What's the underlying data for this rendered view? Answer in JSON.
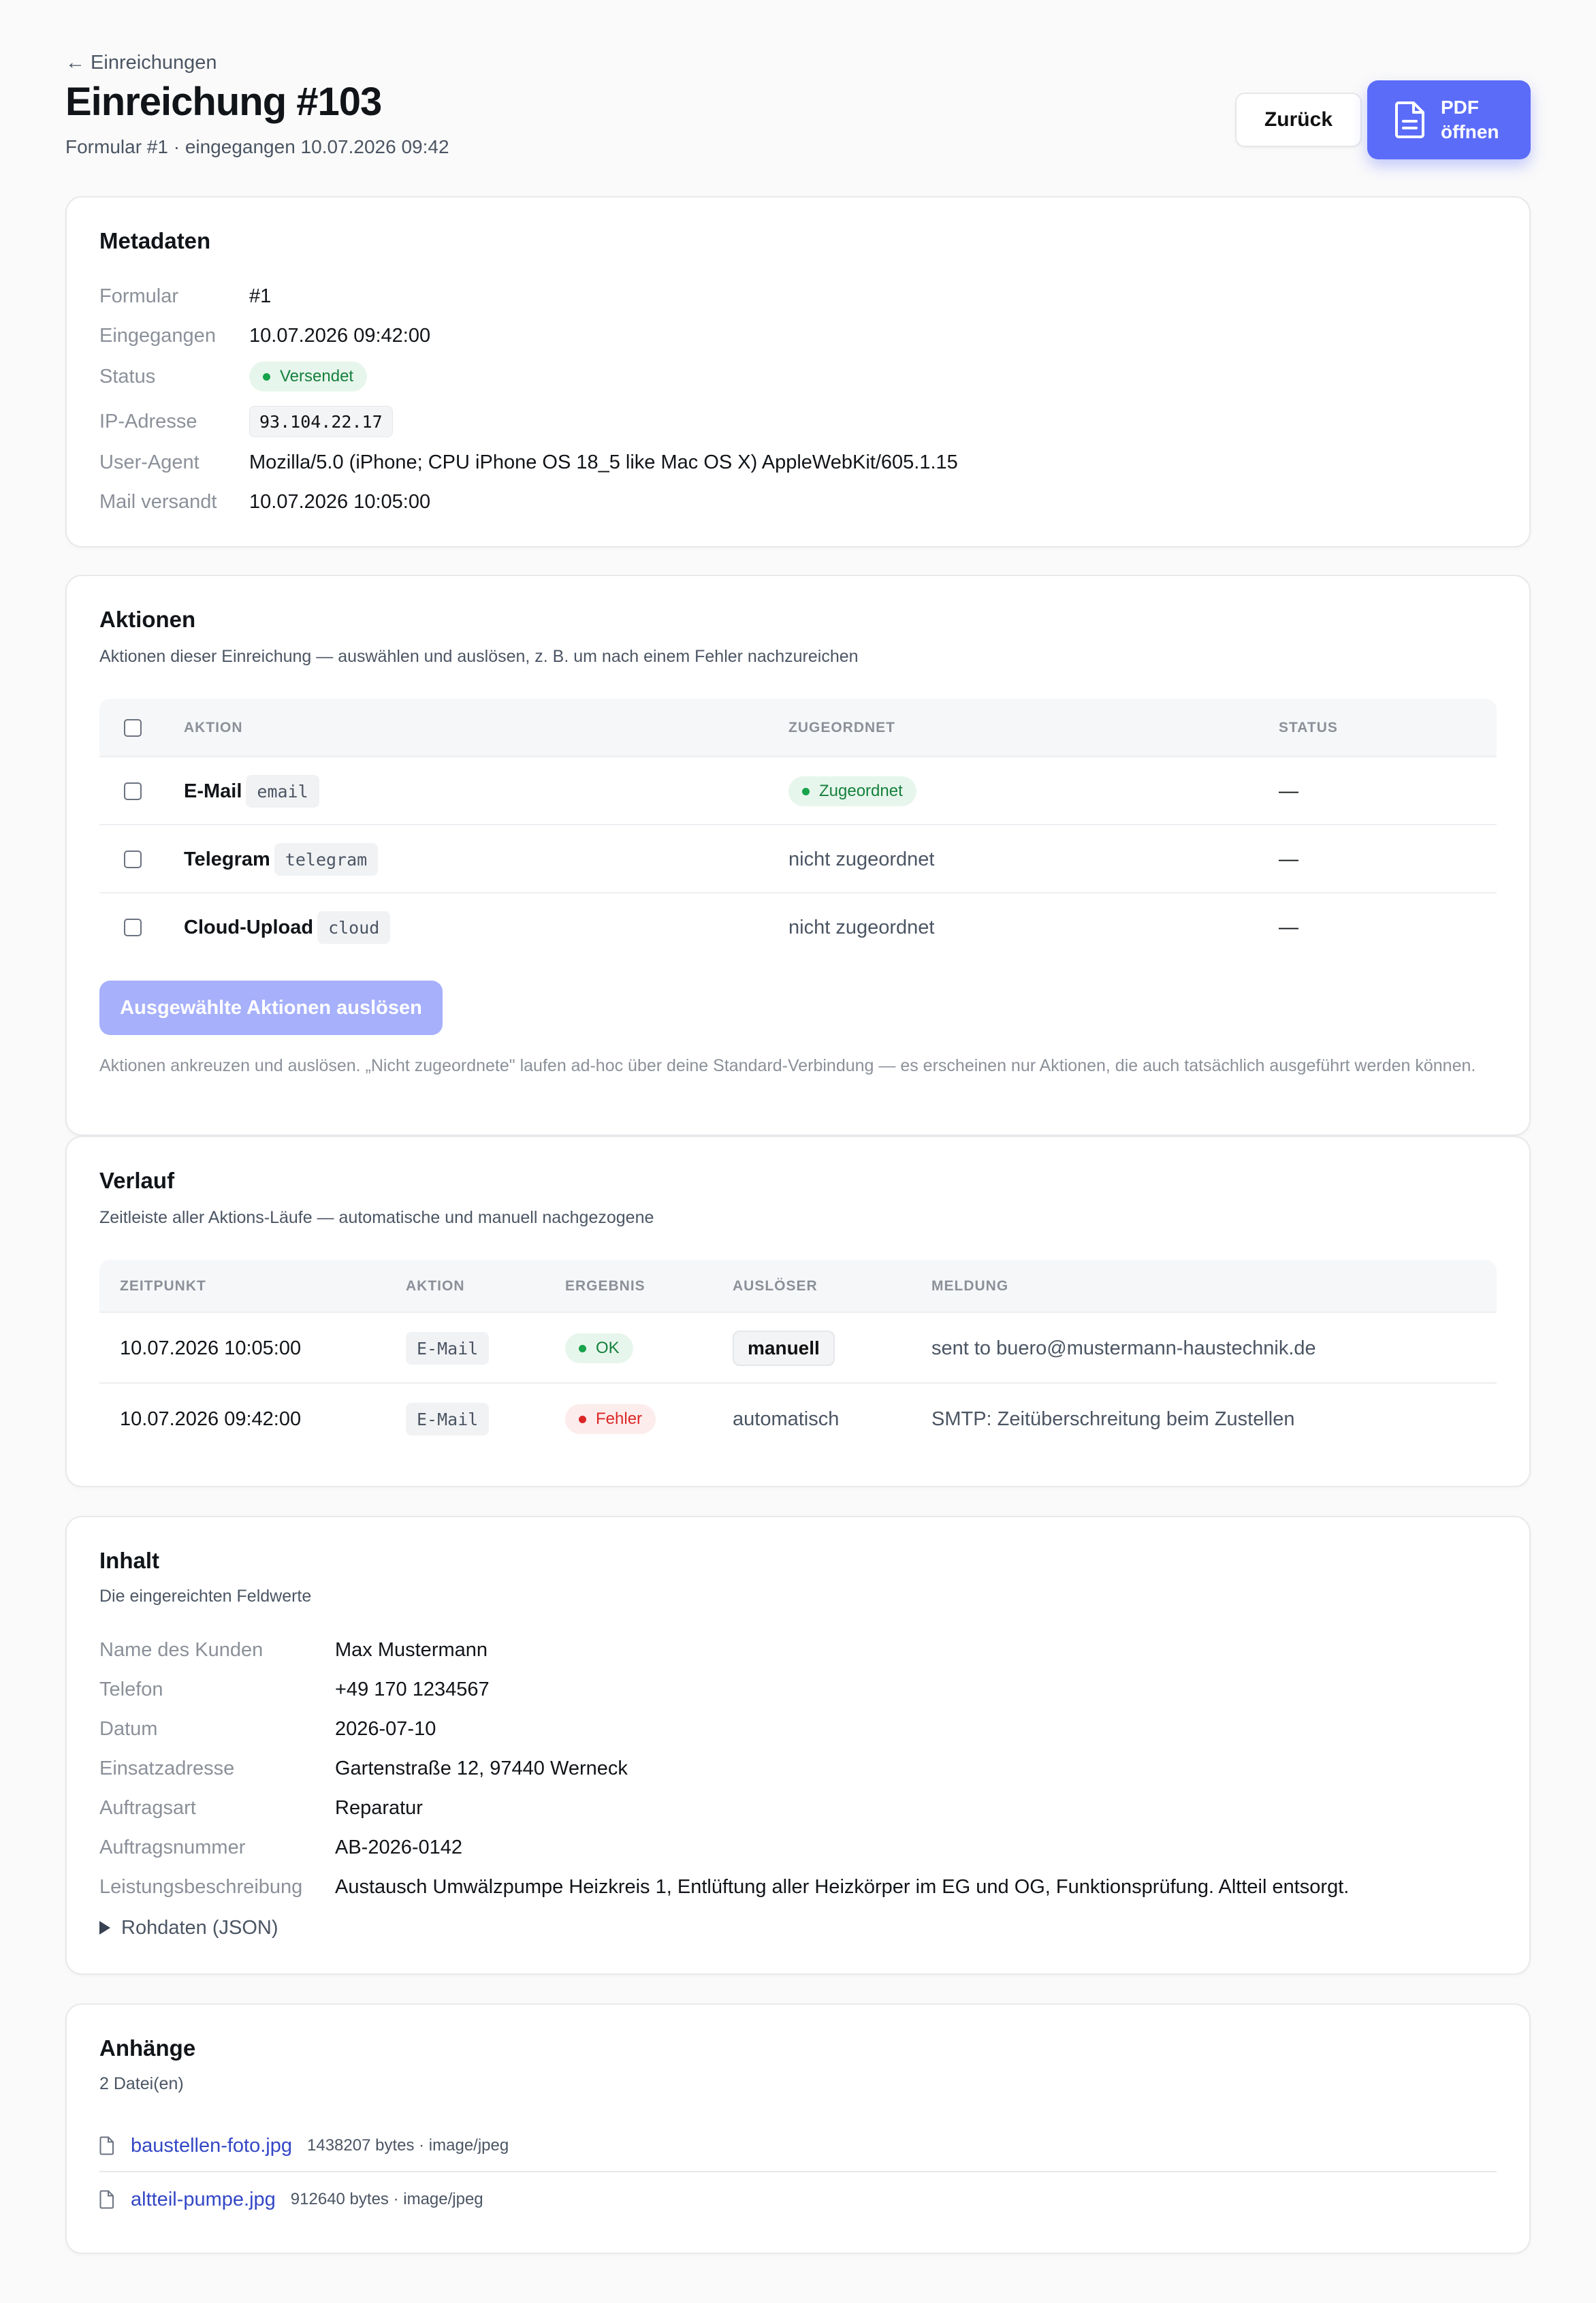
{
  "header": {
    "back_link": "← Einreichungen",
    "title": "Einreichung #103",
    "subtitle": "Formular #1 · eingegangen 10.07.2026 09:42",
    "back_button": "Zurück",
    "pdf_button": "PDF öffnen"
  },
  "metadata": {
    "title": "Metadaten",
    "rows": [
      {
        "key": "Formular",
        "value": "#1"
      },
      {
        "key": "Eingegangen",
        "value": "10.07.2026 09:42:00"
      },
      {
        "key": "Status",
        "value": "Versendet"
      },
      {
        "key": "IP-Adresse",
        "value": "93.104.22.17"
      },
      {
        "key": "User-Agent",
        "value": "Mozilla/5.0 (iPhone; CPU iPhone OS 18_5 like Mac OS X) AppleWebKit/605.1.15"
      },
      {
        "key": "Mail versandt",
        "value": "10.07.2026 10:05:00"
      }
    ]
  },
  "actions": {
    "title": "Aktionen",
    "subtitle": "Aktionen dieser Einreichung — auswählen und auslösen, z. B. um nach einem Fehler nachzureichen",
    "columns": [
      "AKTION",
      "ZUGEORDNET",
      "STATUS"
    ],
    "rows": [
      {
        "name": "E-Mail",
        "code": "email",
        "assigned": "Zugeordnet",
        "status": "—"
      },
      {
        "name": "Telegram",
        "code": "telegram",
        "assigned": "nicht zugeordnet",
        "status": "—"
      },
      {
        "name": "Cloud-Upload",
        "code": "cloud",
        "assigned": "nicht zugeordnet",
        "status": "—"
      }
    ],
    "run_button": "Ausgewählte Aktionen auslösen",
    "note": "Aktionen ankreuzen und auslösen. „Nicht zugeordnete\" laufen ad-hoc über deine Standard-Verbindung — es erscheinen nur Aktionen, die auch tatsächlich ausgeführt werden können."
  },
  "history": {
    "title": "Verlauf",
    "subtitle": "Zeitleiste aller Aktions-Läufe — automatische und manuell nachgezogene",
    "columns": [
      "ZEITPUNKT",
      "AKTION",
      "ERGEBNIS",
      "AUSLÖSER",
      "MELDUNG"
    ],
    "rows": [
      {
        "time": "10.07.2026 10:05:00",
        "action": "E-Mail",
        "result": "OK",
        "trigger": "manuell",
        "message": "sent to buero@mustermann-haustechnik.de"
      },
      {
        "time": "10.07.2026 09:42:00",
        "action": "E-Mail",
        "result": "Fehler",
        "trigger": "automatisch",
        "message": "SMTP: Zeitüberschreitung beim Zustellen"
      }
    ]
  },
  "content": {
    "title": "Inhalt",
    "subtitle": "Die eingereichten Feldwerte",
    "rows": [
      {
        "key": "Name des Kunden",
        "value": "Max Mustermann"
      },
      {
        "key": "Telefon",
        "value": "+49 170 1234567"
      },
      {
        "key": "Datum",
        "value": "2026-07-10"
      },
      {
        "key": "Einsatzadresse",
        "value": "Gartenstraße 12, 97440 Werneck"
      },
      {
        "key": "Auftragsart",
        "value": "Reparatur"
      },
      {
        "key": "Auftragsnummer",
        "value": "AB-2026-0142"
      },
      {
        "key": "Leistungsbeschreibung",
        "value": "Austausch Umwälzpumpe Heizkreis 1, Entlüftung aller Heizkörper im EG und OG, Funktionsprüfung. Altteil entsorgt."
      }
    ],
    "raw_toggle": "Rohdaten (JSON)"
  },
  "attachments": {
    "title": "Anhänge",
    "subtitle": "2 Datei(en)",
    "files": [
      {
        "name": "baustellen-foto.jpg",
        "meta": "1438207 bytes · image/jpeg"
      },
      {
        "name": "altteil-pumpe.jpg",
        "meta": "912640 bytes · image/jpeg"
      }
    ]
  }
}
